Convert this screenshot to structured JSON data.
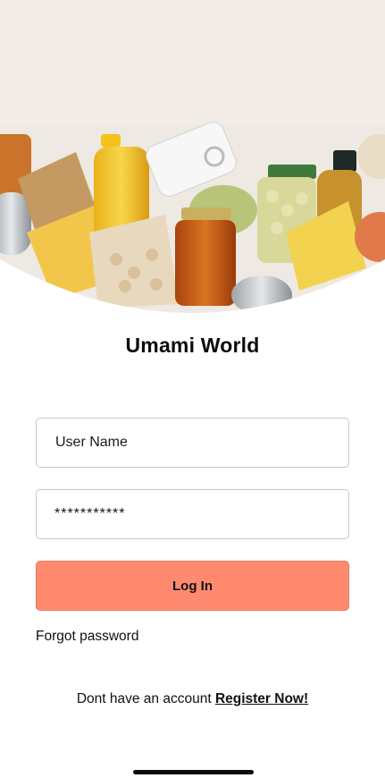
{
  "hero": {
    "image_name": "groceries-photo",
    "bg_color": "#efe9e3"
  },
  "app": {
    "title": "Umami World"
  },
  "form": {
    "username_placeholder": "User Name",
    "password_value": "***********",
    "login_label": "Log In",
    "forgot_label": "Forgot password"
  },
  "register": {
    "prompt": "Dont have an account",
    "link_label": "Register Now!"
  },
  "colors": {
    "accent": "#ff8a70",
    "border": "#c9c9c9"
  }
}
